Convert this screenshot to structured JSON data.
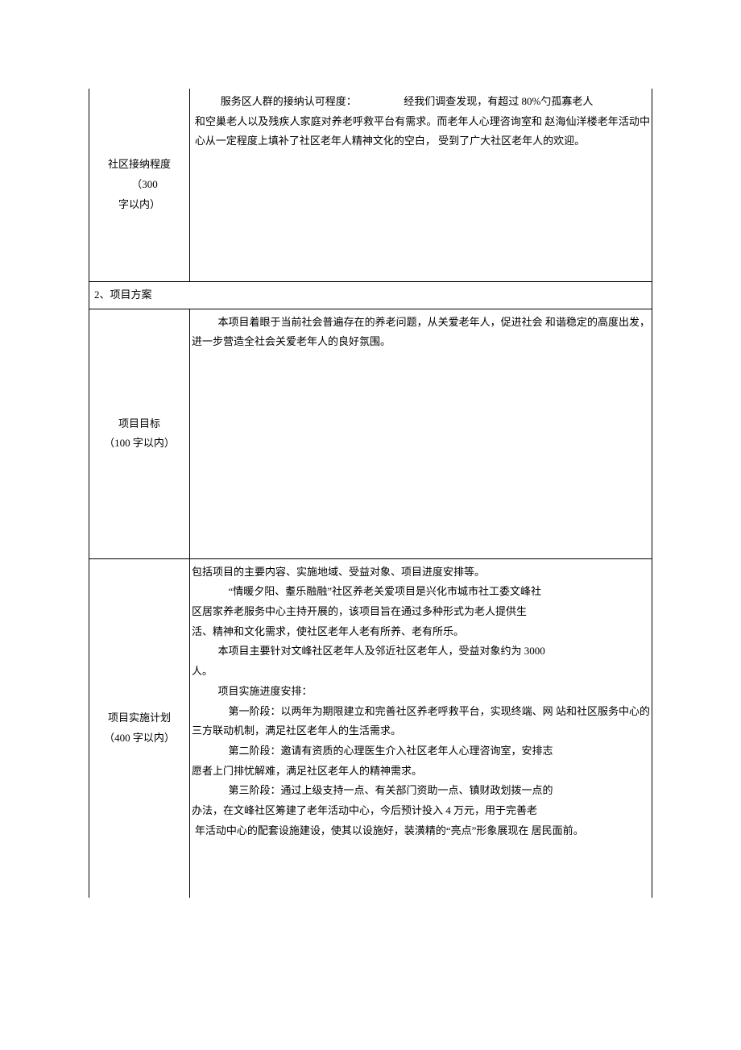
{
  "rows": {
    "r1": {
      "label_line1": "社区接纳程度",
      "label_line2": "（300",
      "label_line3": "字以内）",
      "p1_prefix": "服务区人群的接纳认可程度：",
      "p1_suffix": "经我们调查发现，有超过 80%勺孤寡老人",
      "p2": "和空巢老人以及残疾人家庭对养老呼救平台有需求。而老年人心理咨询室和 赵海仙洋楼老年活动中心从一定程度上填补了社区老年人精神文化的空白， 受到了广大社区老年人的欢迎。"
    },
    "sectionHeader": "2、项目方案",
    "r2": {
      "label_line1": "项目目标",
      "label_line2": "（100 字以内）",
      "p1": "本项目着眼于当前社会普遍存在的养老问题，从关爱老年人，促进社会 和谐稳定的高度出发，进一步营造全社会关爱老年人的良好氛围。"
    },
    "r3": {
      "label_line1": "项目实施计划",
      "label_line2": "（400 字以内）",
      "p1": "包括项目的主要内容、实施地域、受益对象、项目进度安排等。",
      "p2": "“情暖夕阳、耋乐融融”社区养老关爱项目是兴化市城市社工委文峰社",
      "p3": "区居家养老服务中心主持开展的，该项目旨在通过多种形式为老人提供生",
      "p4": "活、精神和文化需求，使社区老年人老有所养、老有所乐。",
      "p5": "本项目主要针对文峰社区老年人及邻近社区老年人，受益对象约为 3000",
      "p6": "人。",
      "p7": "项目实施进度安排：",
      "p8": "第一阶段：以两年为期限建立和完善社区养老呼救平台，实现终端、网 站和社区服务中心的三方联动机制，满足社区老年人的生活需求。",
      "p9": "第二阶段：邀请有资质的心理医生介入社区老年人心理咨询室，安排志",
      "p10": "愿者上门排忧解难，满足社区老年人的精神需求。",
      "p11": "第三阶段：通过上级支持一点、有关部门资助一点、镇财政划拨一点的",
      "p12": "办法，在文峰社区筹建了老年活动中心，今后预计投入 4 万元，用于完善老",
      "p13": "年活动中心的配套设施建设，使其以设施好，装潢精的“亮点”形象展现在 居民面前。"
    }
  }
}
